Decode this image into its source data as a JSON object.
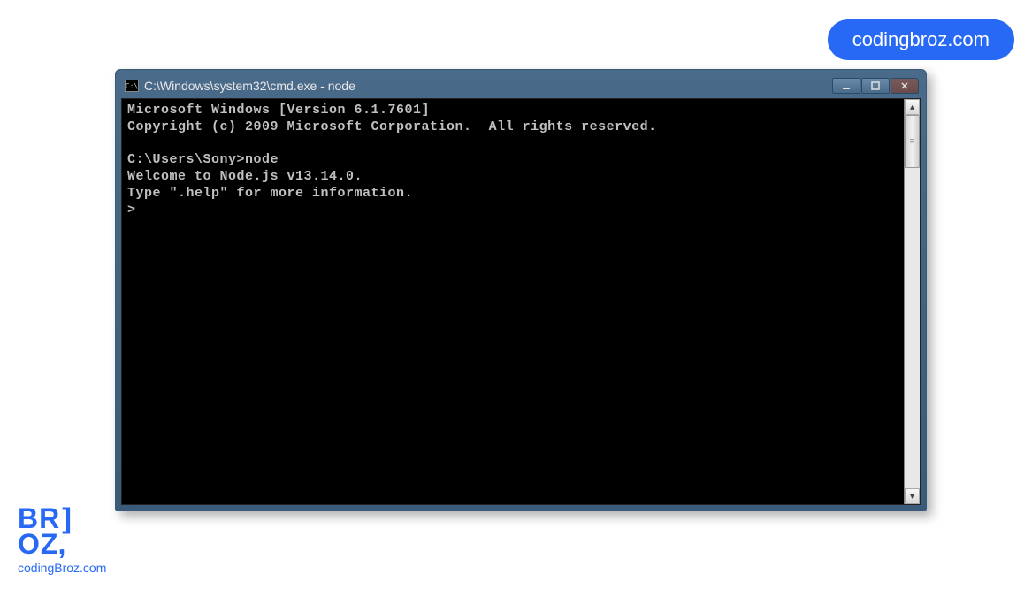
{
  "watermark": {
    "pill": "codingbroz.com",
    "logo_line1": "BR",
    "logo_line2": "OZ",
    "logo_footer": "codingBroz.com"
  },
  "window": {
    "title": "C:\\Windows\\system32\\cmd.exe - node"
  },
  "terminal": {
    "line1": "Microsoft Windows [Version 6.1.7601]",
    "line2": "Copyright (c) 2009 Microsoft Corporation.  All rights reserved.",
    "blank1": "",
    "prompt_line": "C:\\Users\\Sony>node",
    "welcome": "Welcome to Node.js v13.14.0.",
    "help": "Type \".help\" for more information.",
    "repl_prompt": ">"
  }
}
